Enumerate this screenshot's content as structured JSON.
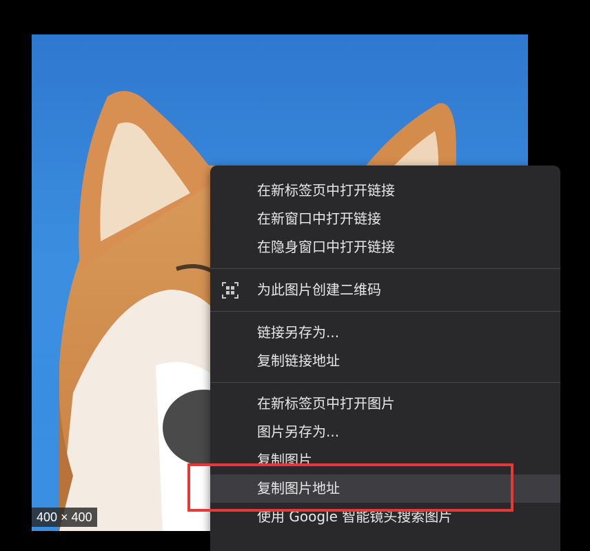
{
  "image": {
    "dimensions_badge": "400 × 400",
    "subject_icon": "shiba-dog-photo"
  },
  "context_menu": {
    "groups": [
      [
        {
          "label": "在新标签页中打开链接"
        },
        {
          "label": "在新窗口中打开链接"
        },
        {
          "label": "在隐身窗口中打开链接"
        }
      ],
      [
        {
          "label": "为此图片创建二维码",
          "icon": "qr-code-icon"
        }
      ],
      [
        {
          "label": "链接另存为..."
        },
        {
          "label": "复制链接地址"
        }
      ],
      [
        {
          "label": "在新标签页中打开图片"
        },
        {
          "label": "图片另存为..."
        },
        {
          "label": "复制图片"
        },
        {
          "label": "复制图片地址",
          "state": "hovered"
        },
        {
          "label": "使用 Google 智能镜头搜索图片"
        }
      ]
    ]
  },
  "annotation": {
    "color": "#e53935",
    "target": "复制图片地址"
  },
  "colors": {
    "menu_background": "#29292c",
    "menu_hover": "#3e3e42",
    "menu_text": "#e8e8e8",
    "sky": "#3a8fe3"
  }
}
